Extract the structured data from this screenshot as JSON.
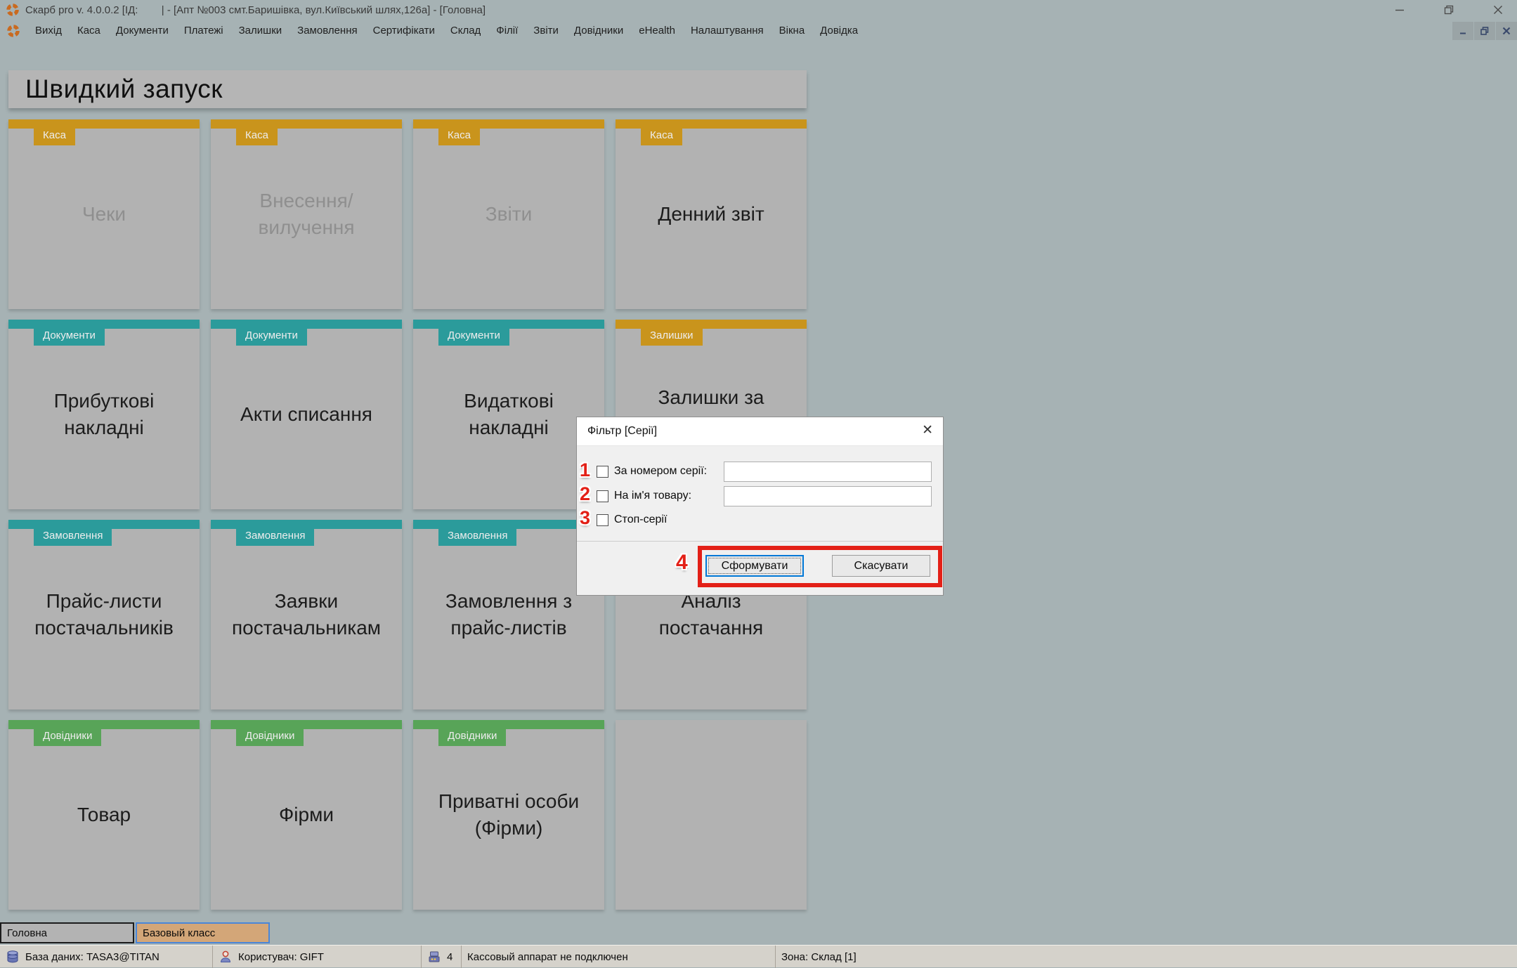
{
  "window": {
    "title": "Скарб pro v. 4.0.0.2 [ІД:        | - [Апт №003 смт.Баришівка, вул.Київський шлях,126а] - [Головна]"
  },
  "menu": {
    "items": [
      "Вихід",
      "Каса",
      "Документи",
      "Платежі",
      "Залишки",
      "Замовлення",
      "Сертифікати",
      "Склад",
      "Філії",
      "Звіти",
      "Довідники",
      "eHealth",
      "Налаштування",
      "Вікна",
      "Довідка"
    ]
  },
  "quick_launch": {
    "header": "Швидкий запуск",
    "tiles": [
      {
        "category": "Каса",
        "label": "Чеки",
        "enabled": false
      },
      {
        "category": "Каса",
        "label": "Внесення/вилучення",
        "enabled": false
      },
      {
        "category": "Каса",
        "label": "Звіти",
        "enabled": false
      },
      {
        "category": "Каса",
        "label": "Денний звіт",
        "enabled": true
      },
      {
        "category": "Документи",
        "label": "Прибуткові накладні",
        "enabled": true
      },
      {
        "category": "Документи",
        "label": "Акти списання",
        "enabled": true
      },
      {
        "category": "Документи",
        "label": "Видаткові накладні",
        "enabled": true
      },
      {
        "category": "Залишки",
        "label": "Залишки за",
        "enabled": true
      },
      {
        "category": "Замовлення",
        "label": "Прайс-листи постачальників",
        "enabled": true
      },
      {
        "category": "Замовлення",
        "label": "Заявки постачальникам",
        "enabled": true
      },
      {
        "category": "Замовлення",
        "label": "Замовлення з прайс-листів",
        "enabled": true
      },
      {
        "category": "",
        "label": "Аналіз постачання",
        "enabled": true
      },
      {
        "category": "Довідники",
        "label": "Товар",
        "enabled": true
      },
      {
        "category": "Довідники",
        "label": "Фірми",
        "enabled": true
      },
      {
        "category": "Довідники",
        "label": "Приватні особи (Фірми)",
        "enabled": true
      },
      {
        "category": "",
        "label": "",
        "enabled": false
      }
    ]
  },
  "dialog": {
    "title": "Фільтр [Серії]",
    "close_glyph": "✕",
    "fields": [
      {
        "annotation": "1",
        "label": "За номером серії:",
        "value": "",
        "checked": false
      },
      {
        "annotation": "2",
        "label": "На ім'я товару:",
        "value": "",
        "checked": false
      },
      {
        "annotation": "3",
        "label": "Стоп-серії",
        "checked": false
      }
    ],
    "buttons_annotation": "4",
    "buttons": [
      {
        "label": "Сформувати",
        "focused": true
      },
      {
        "label": "Скасувати",
        "focused": false
      }
    ]
  },
  "tabs": [
    {
      "label": "Головна",
      "active": false
    },
    {
      "label": "Базовый класс",
      "active": true
    }
  ],
  "status_bar": {
    "items": [
      {
        "icon": "database-icon",
        "text": "База даних: TASA3@TITAN"
      },
      {
        "icon": "user-icon",
        "text": "Користувач: GIFT"
      },
      {
        "icon": "cash-register-icon",
        "text": "4"
      },
      {
        "icon": "",
        "text": "Кассовый аппарат не подключен"
      },
      {
        "icon": "",
        "text": "Зона: Склад [1]"
      }
    ]
  },
  "icons": {
    "app-logo": "orange segmented ring",
    "minimize-icon": "–",
    "restore-icon": "❐",
    "close-icon": "✕"
  },
  "colors": {
    "background": "#a6b2b4",
    "tile": "#b2b2b2",
    "accent_gold": "#c9941c",
    "accent_teal": "#2b9b9b",
    "accent_green": "#58a458",
    "annotation_red": "#e32017",
    "focus_blue": "#0078d7",
    "tab_active_tan": "#d3a678"
  }
}
